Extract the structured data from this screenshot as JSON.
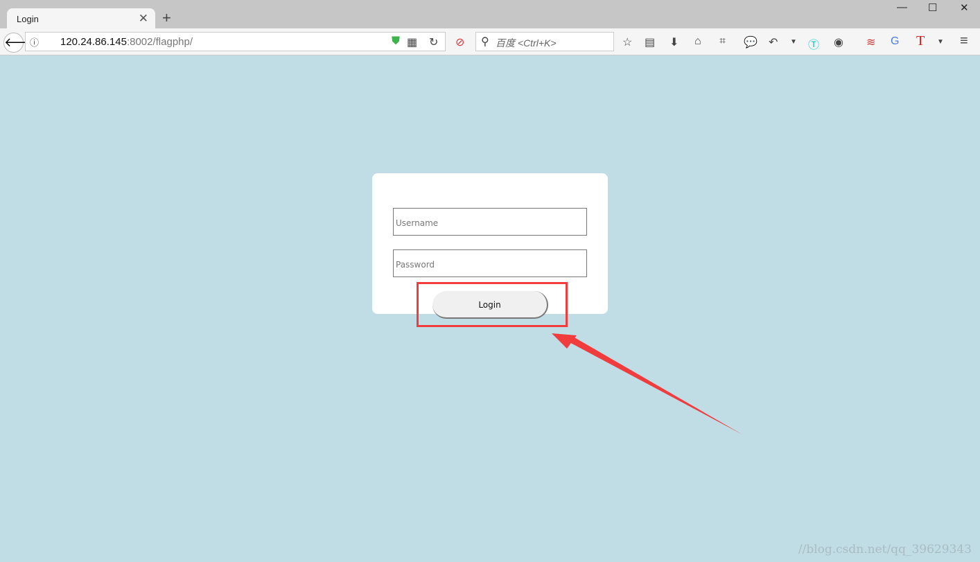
{
  "browser": {
    "tab_title": "Login",
    "url_host": "120.24.86.145",
    "url_rest": ":8002/flagphp/",
    "search_placeholder": "百度 <Ctrl+K>"
  },
  "form": {
    "username_placeholder": "Username",
    "password_placeholder": "Password",
    "login_label": "Login"
  },
  "annotation": {
    "color": "#f03c3c"
  },
  "watermark": "//blog.csdn.net/qq_39629343"
}
